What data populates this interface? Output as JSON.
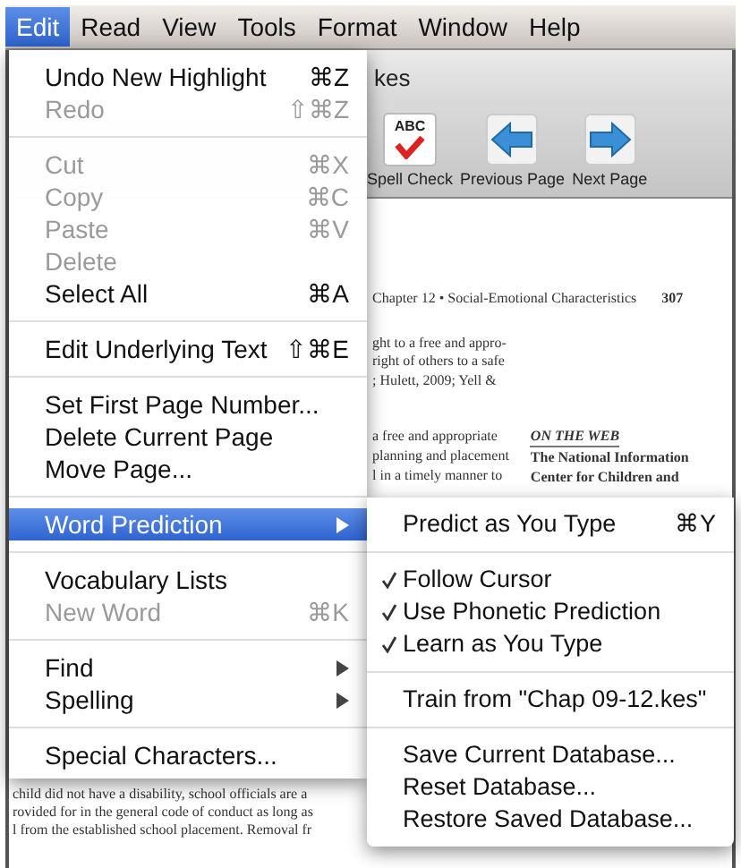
{
  "menu_bar": [
    {
      "label": "Edit",
      "selected": true
    },
    {
      "label": "Read",
      "selected": false
    },
    {
      "label": "View",
      "selected": false
    },
    {
      "label": "Tools",
      "selected": false
    },
    {
      "label": "Format",
      "selected": false
    },
    {
      "label": "Window",
      "selected": false
    },
    {
      "label": "Help",
      "selected": false
    }
  ],
  "window": {
    "title": "kes",
    "toolbar": [
      {
        "label": "Spell Check",
        "kind": "spell",
        "icon_text": "ABC"
      },
      {
        "label": "Previous Page",
        "kind": "prev"
      },
      {
        "label": "Next Page",
        "kind": "next"
      }
    ]
  },
  "document": {
    "header": "Chapter 12 • Social-Emotional Characteristics",
    "page_number": "307",
    "lines_top": [
      "ght to a free and appro-",
      "right of others to a safe",
      "; Hulett, 2009; Yell &"
    ],
    "lines_middle": [
      "a free and appropriate",
      "planning and placement",
      "l in a timely manner to"
    ],
    "sidebar_heading": "ON THE WEB",
    "sidebar_lines": [
      "The National Information",
      "Center for Children and"
    ],
    "lines_bottom": [
      "child did not have a disability, school officials are a",
      "rovided for in the general code of conduct as long as",
      "l from the established school placement. Removal fr"
    ]
  },
  "edit_menu": [
    {
      "kind": "item",
      "label": "Undo New Highlight",
      "shortcut": "⌘Z",
      "disabled": false,
      "submenu": false,
      "selected": false
    },
    {
      "kind": "item",
      "label": "Redo",
      "shortcut": "⇧⌘Z",
      "disabled": true,
      "submenu": false,
      "selected": false
    },
    {
      "kind": "separator"
    },
    {
      "kind": "item",
      "label": "Cut",
      "shortcut": "⌘X",
      "disabled": true,
      "submenu": false,
      "selected": false
    },
    {
      "kind": "item",
      "label": "Copy",
      "shortcut": "⌘C",
      "disabled": true,
      "submenu": false,
      "selected": false
    },
    {
      "kind": "item",
      "label": "Paste",
      "shortcut": "⌘V",
      "disabled": true,
      "submenu": false,
      "selected": false
    },
    {
      "kind": "item",
      "label": "Delete",
      "disabled": true,
      "submenu": false,
      "selected": false
    },
    {
      "kind": "item",
      "label": "Select All",
      "shortcut": "⌘A",
      "disabled": false,
      "submenu": false,
      "selected": false
    },
    {
      "kind": "separator"
    },
    {
      "kind": "item",
      "label": "Edit Underlying Text",
      "shortcut": "⇧⌘E",
      "disabled": false,
      "submenu": false,
      "selected": false
    },
    {
      "kind": "separator"
    },
    {
      "kind": "item",
      "label": "Set First Page Number...",
      "disabled": false,
      "submenu": false,
      "selected": false
    },
    {
      "kind": "item",
      "label": "Delete Current Page",
      "disabled": false,
      "submenu": false,
      "selected": false
    },
    {
      "kind": "item",
      "label": "Move Page...",
      "disabled": false,
      "submenu": false,
      "selected": false
    },
    {
      "kind": "separator"
    },
    {
      "kind": "item",
      "label": "Word Prediction",
      "disabled": false,
      "submenu": true,
      "selected": true
    },
    {
      "kind": "separator"
    },
    {
      "kind": "item",
      "label": "Vocabulary Lists",
      "disabled": false,
      "submenu": false,
      "selected": false
    },
    {
      "kind": "item",
      "label": "New Word",
      "shortcut": "⌘K",
      "disabled": true,
      "submenu": false,
      "selected": false
    },
    {
      "kind": "separator"
    },
    {
      "kind": "item",
      "label": "Find",
      "disabled": false,
      "submenu": true,
      "selected": false
    },
    {
      "kind": "item",
      "label": "Spelling",
      "disabled": false,
      "submenu": true,
      "selected": false
    },
    {
      "kind": "separator"
    },
    {
      "kind": "item",
      "label": "Special Characters...",
      "disabled": false,
      "submenu": false,
      "selected": false
    }
  ],
  "word_prediction_menu": [
    {
      "kind": "item",
      "label": "Predict as You Type",
      "shortcut": "⌘Y",
      "checked": false
    },
    {
      "kind": "separator"
    },
    {
      "kind": "item",
      "label": "Follow Cursor",
      "checked": true
    },
    {
      "kind": "item",
      "label": "Use Phonetic Prediction",
      "checked": true
    },
    {
      "kind": "item",
      "label": "Learn as You Type",
      "checked": true
    },
    {
      "kind": "separator"
    },
    {
      "kind": "item",
      "label": "Train from \"Chap 09-12.kes\"",
      "checked": false
    },
    {
      "kind": "separator"
    },
    {
      "kind": "item",
      "label": "Save Current Database...",
      "checked": false
    },
    {
      "kind": "item",
      "label": "Reset Database...",
      "checked": false
    },
    {
      "kind": "item",
      "label": "Restore Saved Database...",
      "checked": false
    }
  ]
}
